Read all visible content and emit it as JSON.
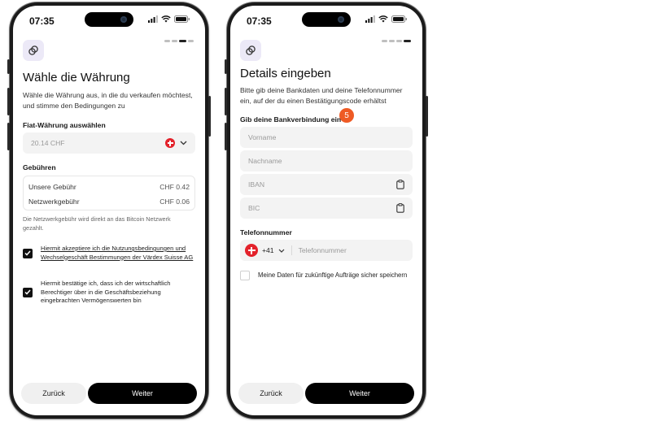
{
  "status": {
    "time": "07:35"
  },
  "screen1": {
    "title": "Wähle die Währung",
    "description": "Wähle die Währung aus, in die du verkaufen möchtest, und stimme den Bedingungen zu",
    "fiat_label": "Fiat-Währung auswählen",
    "amount": "20.14 CHF",
    "fees_label": "Gebühren",
    "fees": [
      {
        "label": "Unsere Gebühr",
        "value": "CHF 0.42"
      },
      {
        "label": "Netzwerkgebühr",
        "value": "CHF 0.06"
      }
    ],
    "network_note": "Die Netzwerkgebühr wird direkt an das Bitcoin Netzwerk gezahlt.",
    "terms_text": "Hiermit akzeptiere ich die Nutzungsbedingungen und Wechselgeschäft Bestimmungen der Värdex Suisse AG",
    "beneficiary_text": "Hiermit bestätige ich, dass ich der wirtschaftlich Berechtiger über in die Geschäftsbeziehung eingebrachten Vermögenswerten bin",
    "back_label": "Zurück",
    "next_label": "Weiter"
  },
  "screen2": {
    "title": "Details eingeben",
    "description": "Bitte gib deine Bankdaten und deine Telefonnummer ein, auf der du einen Bestätigungscode erhältst",
    "bank_label": "Gib deine Bankverbindung ein",
    "step_badge": "5",
    "firstname_placeholder": "Vorname",
    "lastname_placeholder": "Nachname",
    "iban_placeholder": "IBAN",
    "bic_placeholder": "BIC",
    "phone_label": "Telefonnummer",
    "country_code": "+41",
    "phone_placeholder": "Telefonnummer",
    "save_label": "Meine Daten für zukünftige Aufträge sicher speichern",
    "back_label": "Zurück",
    "next_label": "Weiter"
  },
  "colors": {
    "accent": "#000000",
    "badge": "#ee5a24",
    "swiss_red": "#e3222b",
    "logo_bg": "#ece9f7"
  },
  "icons": [
    "app-logo-icon",
    "swiss-flag-icon",
    "chevron-down-icon",
    "clipboard-icon",
    "checkmark-icon",
    "signal-icon",
    "wifi-icon",
    "battery-icon"
  ]
}
